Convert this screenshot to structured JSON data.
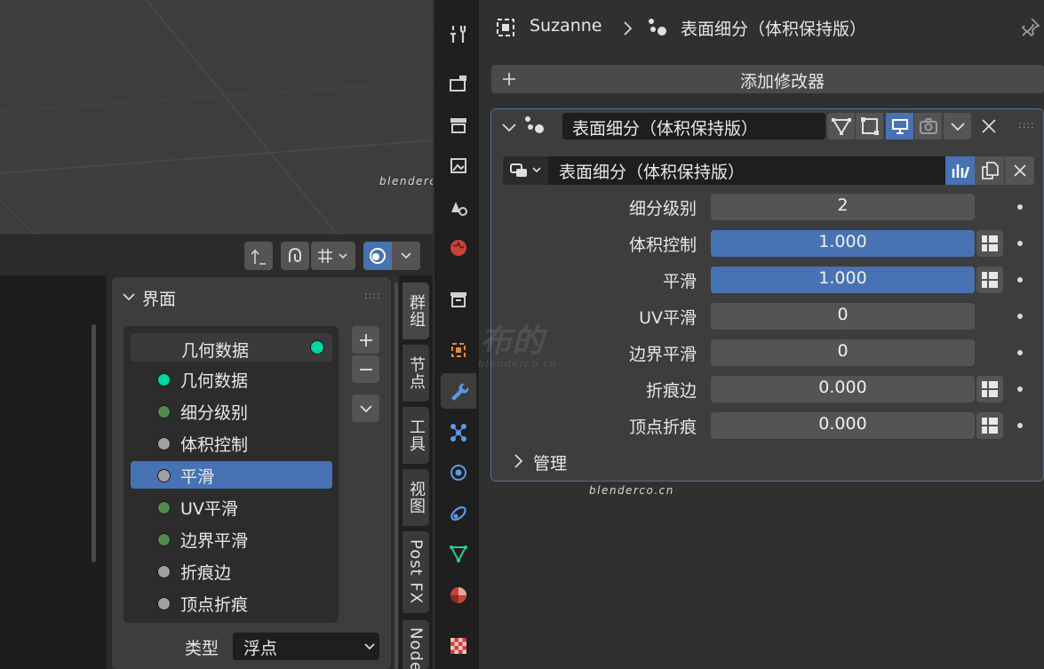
{
  "viewport": {
    "watermark": "blenderco.cn",
    "watermark_cn": "布的"
  },
  "node_panel": {
    "title": "界面",
    "list_header": "几何数据",
    "sockets": [
      {
        "label": "几何数据",
        "color": "#00d6a3",
        "selected": false
      },
      {
        "label": "细分级别",
        "color": "#4e8a4e",
        "selected": false
      },
      {
        "label": "体积控制",
        "color": "#a1a1a1",
        "selected": false
      },
      {
        "label": "平滑",
        "color": "#a1a1a1",
        "selected": true
      },
      {
        "label": "UV平滑",
        "color": "#4e8a4e",
        "selected": false
      },
      {
        "label": "边界平滑",
        "color": "#4e8a4e",
        "selected": false
      },
      {
        "label": "折痕边",
        "color": "#a1a1a1",
        "selected": false
      },
      {
        "label": "顶点折痕",
        "color": "#a1a1a1",
        "selected": false
      }
    ],
    "type_label": "类型",
    "type_value": "浮点",
    "tabs": [
      "群组",
      "节点",
      "工具",
      "视图",
      "Post FX",
      "Node"
    ]
  },
  "properties": {
    "breadcrumb_object": "Suzanne",
    "breadcrumb_modifier": "表面细分（体积保持版）",
    "add_modifier": "添加修改器",
    "modifier_name": "表面细分（体积保持版）",
    "node_group": "表面细分（体积保持版）",
    "rows": [
      {
        "label": "细分级别",
        "value": "2",
        "style": "gray",
        "keyframe": false
      },
      {
        "label": "体积控制",
        "value": "1.000",
        "style": "blue",
        "keyframe": true
      },
      {
        "label": "平滑",
        "value": "1.000",
        "style": "blue",
        "keyframe": true
      },
      {
        "label": "UV平滑",
        "value": "0",
        "style": "gray",
        "keyframe": false
      },
      {
        "label": "边界平滑",
        "value": "0",
        "style": "gray",
        "keyframe": false
      },
      {
        "label": "折痕边",
        "value": "0.000",
        "style": "gray",
        "keyframe": true
      },
      {
        "label": "顶点折痕",
        "value": "0.000",
        "style": "gray",
        "keyframe": true
      }
    ],
    "manage": "管理"
  },
  "colors": {
    "accent": "#4772b3",
    "modifier_outline": "#4f6f9f"
  }
}
